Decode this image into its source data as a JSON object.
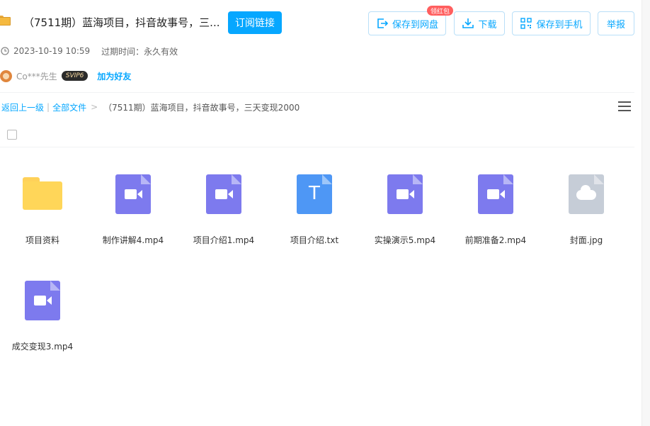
{
  "header": {
    "title": "（7511期）蓝海项目，抖音故事号，三...",
    "subscribe_label": "订阅链接",
    "save_disk_label": "保存到网盘",
    "save_disk_badge": "领红包",
    "download_label": "下载",
    "save_phone_label": "保存到手机",
    "report_label": "举报"
  },
  "meta": {
    "datetime": "2023-10-19 10:59",
    "expire_label": "过期时间：永久有效"
  },
  "user": {
    "name": "Co***先生",
    "vip_badge": "SVIP6",
    "add_friend_label": "加为好友"
  },
  "breadcrumb": {
    "back_label": "返回上一级",
    "separator": "|",
    "all_files_label": "全部文件",
    "arrow": ">",
    "current": "（7511期）蓝海项目，抖音故事号，三天变现2000"
  },
  "files": [
    {
      "name": "项目资料",
      "type": "folder"
    },
    {
      "name": "制作讲解4.mp4",
      "type": "video"
    },
    {
      "name": "项目介绍1.mp4",
      "type": "video"
    },
    {
      "name": "项目介绍.txt",
      "type": "text"
    },
    {
      "name": "实操演示5.mp4",
      "type": "video"
    },
    {
      "name": "前期准备2.mp4",
      "type": "video"
    },
    {
      "name": "封面.jpg",
      "type": "image"
    },
    {
      "name": "成交变现3.mp4",
      "type": "video"
    }
  ],
  "icons": {
    "header_folder": "folder-icon",
    "save_disk": "save-to-disk-icon",
    "download": "download-icon",
    "save_phone": "qr-code-icon",
    "clock": "clock-icon",
    "list_view": "list-view-icon",
    "text_glyph": "T"
  },
  "colors": {
    "accent": "#06a7ff",
    "video": "#7d7aee",
    "text_file": "#4e97f5",
    "image_file": "#c6cdd7",
    "folder": "#ffd659",
    "badge": "#ff5f5f"
  }
}
